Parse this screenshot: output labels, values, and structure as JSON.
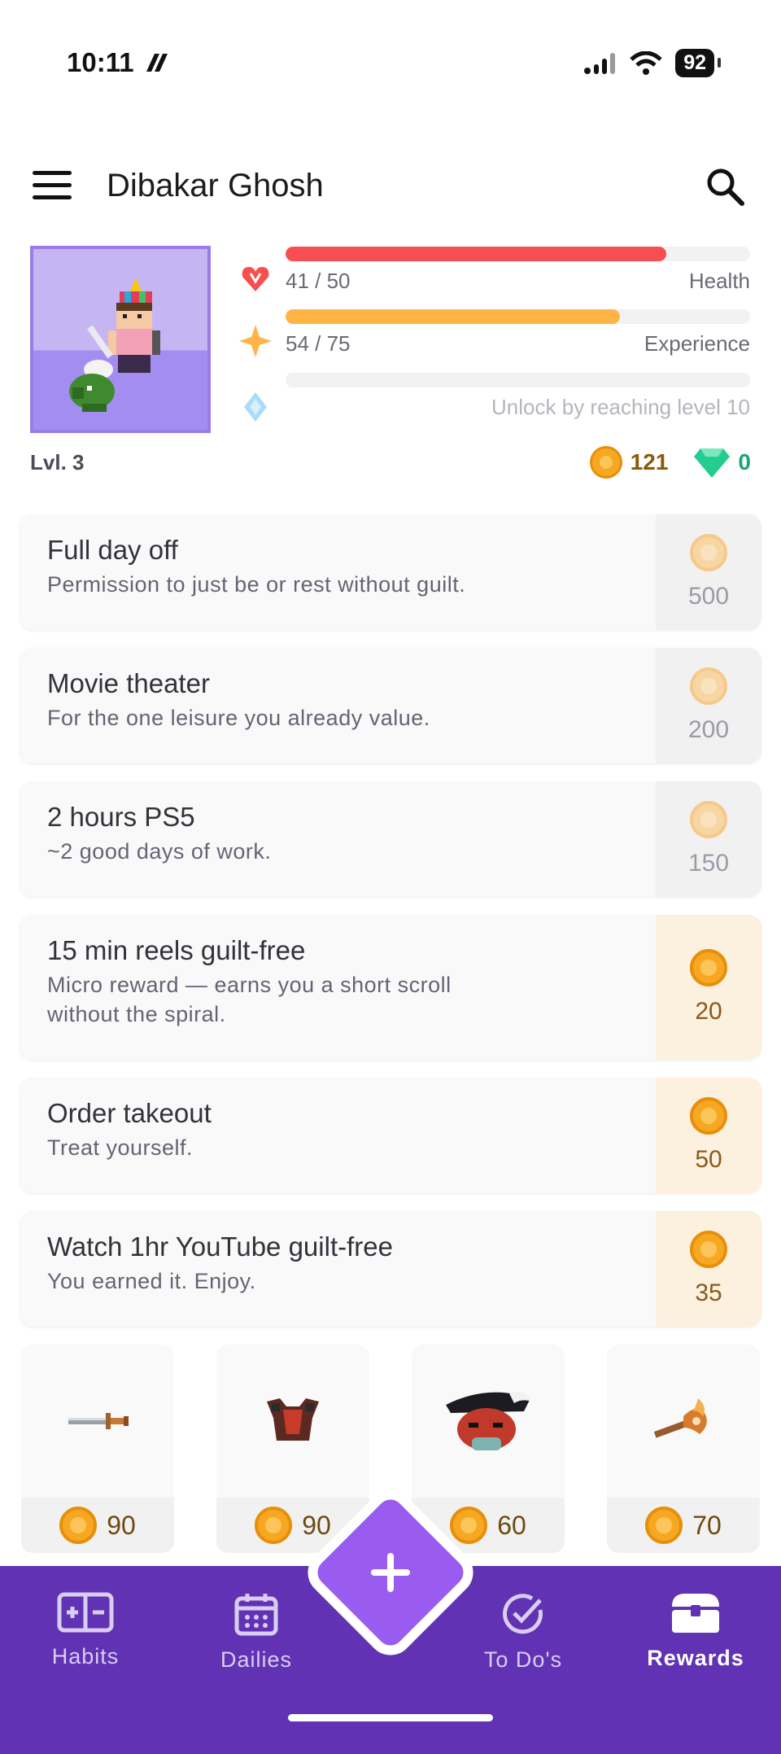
{
  "status_bar": {
    "time": "10:11",
    "battery": "92"
  },
  "header": {
    "title": "Dibakar Ghosh"
  },
  "profile": {
    "level": "Lvl. 3",
    "health": {
      "value": "41 / 50",
      "label": "Health",
      "fraction": 0.82,
      "color": "#f74e52"
    },
    "experience": {
      "value": "54 / 75",
      "label": "Experience",
      "fraction": 0.72,
      "color": "#ffb445"
    },
    "mana": {
      "label": "Unlock by reaching level 10"
    },
    "gold": "121",
    "gems": "0"
  },
  "rewards": [
    {
      "title": "Full day off",
      "notes": "Permission to just be or rest without guilt.",
      "price": "500",
      "affordable": false
    },
    {
      "title": "Movie theater",
      "notes": "For the one leisure you already value.",
      "price": "200",
      "affordable": false
    },
    {
      "title": "2 hours PS5",
      "notes": "~2 good days of work.",
      "price": "150",
      "affordable": false
    },
    {
      "title": "15 min reels guilt-free",
      "notes": "Micro reward — earns you a short scroll without the spiral.",
      "price": "20",
      "affordable": true
    },
    {
      "title": "Order takeout",
      "notes": "Treat yourself.",
      "price": "50",
      "affordable": true
    },
    {
      "title": "Watch 1hr YouTube guilt-free",
      "notes": "You earned it. Enjoy.",
      "price": "35",
      "affordable": true
    }
  ],
  "shop_items": [
    {
      "icon": "sword-icon",
      "price": "90"
    },
    {
      "icon": "armor-icon",
      "price": "90"
    },
    {
      "icon": "pirate-hat-icon",
      "price": "60"
    },
    {
      "icon": "flame-axe-icon",
      "price": "70"
    }
  ],
  "bottom_nav": {
    "habits": "Habits",
    "dailies": "Dailies",
    "todos": "To Do's",
    "rewards": "Rewards"
  }
}
